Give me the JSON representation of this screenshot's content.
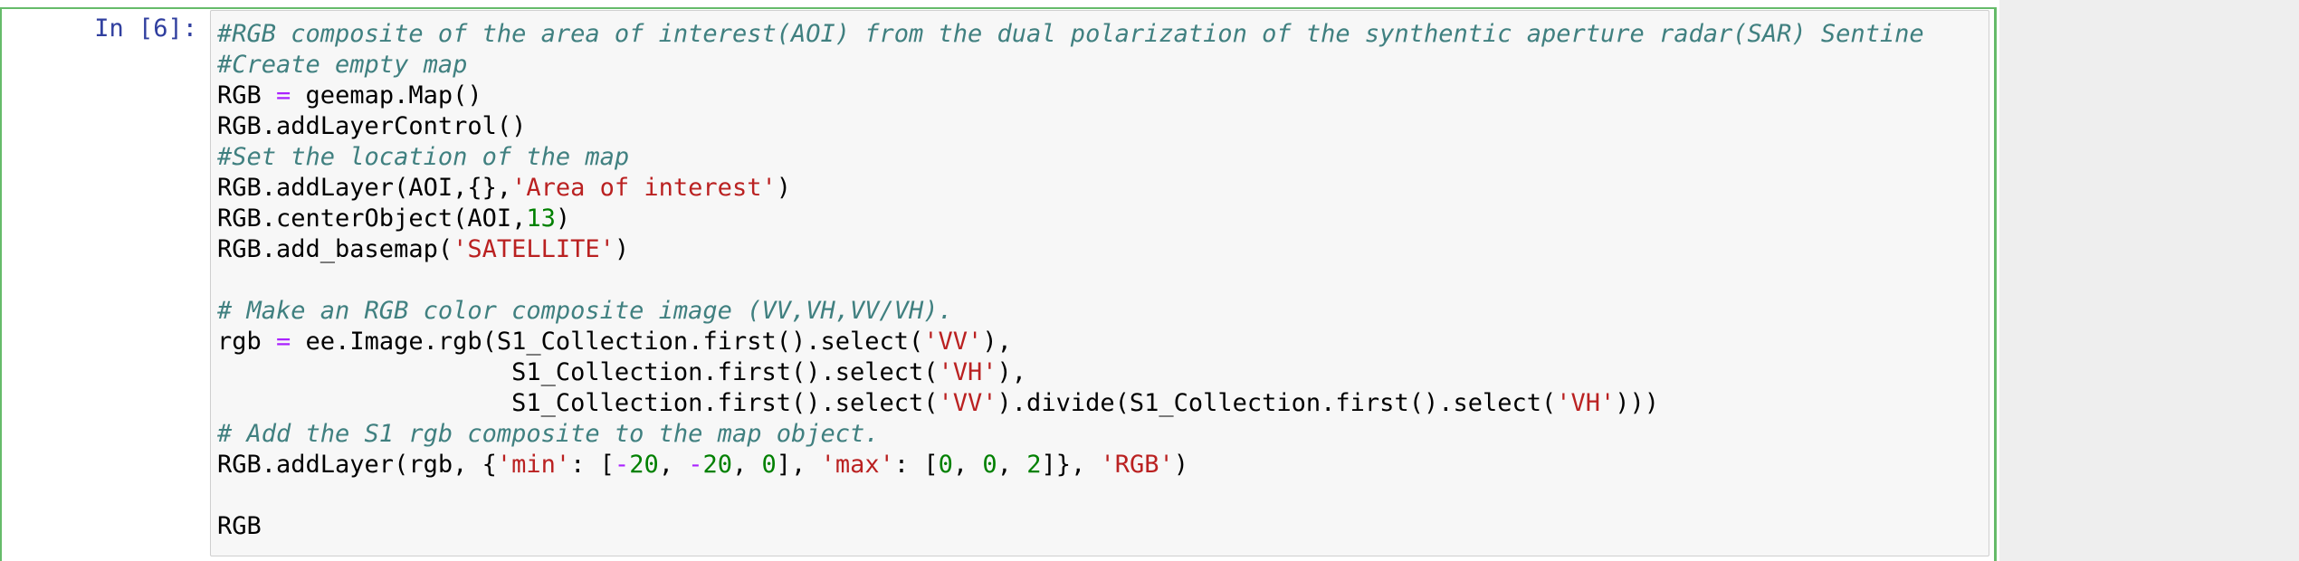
{
  "notebook": {
    "cell": {
      "prompt": "In [6]:",
      "lines": [
        [
          {
            "t": "#RGB composite of the area of interest(AOI) from the dual polarization of the synthentic aperture radar(SAR) Sentine",
            "k": "c"
          }
        ],
        [
          {
            "t": "#Create empty map",
            "k": "c"
          }
        ],
        [
          {
            "t": "RGB ",
            "k": "p"
          },
          {
            "t": "=",
            "k": "o"
          },
          {
            "t": " geemap.Map()",
            "k": "p"
          }
        ],
        [
          {
            "t": "RGB.addLayerControl()",
            "k": "p"
          }
        ],
        [
          {
            "t": "#Set the location of the map",
            "k": "c"
          }
        ],
        [
          {
            "t": "RGB.addLayer(AOI,{},",
            "k": "p"
          },
          {
            "t": "'Area of interest'",
            "k": "s"
          },
          {
            "t": ")",
            "k": "p"
          }
        ],
        [
          {
            "t": "RGB.centerObject(AOI,",
            "k": "p"
          },
          {
            "t": "13",
            "k": "n"
          },
          {
            "t": ")",
            "k": "p"
          }
        ],
        [
          {
            "t": "RGB.add_basemap(",
            "k": "p"
          },
          {
            "t": "'SATELLITE'",
            "k": "s"
          },
          {
            "t": ")",
            "k": "p"
          }
        ],
        [],
        [
          {
            "t": "# Make an RGB color composite image (VV,VH,VV/VH).",
            "k": "c"
          }
        ],
        [
          {
            "t": "rgb ",
            "k": "p"
          },
          {
            "t": "=",
            "k": "o"
          },
          {
            "t": " ee.Image.rgb(S1_Collection.first().select(",
            "k": "p"
          },
          {
            "t": "'VV'",
            "k": "s"
          },
          {
            "t": "),",
            "k": "p"
          }
        ],
        [
          {
            "t": "                    S1_Collection.first().select(",
            "k": "p"
          },
          {
            "t": "'VH'",
            "k": "s"
          },
          {
            "t": "),",
            "k": "p"
          }
        ],
        [
          {
            "t": "                    S1_Collection.first().select(",
            "k": "p"
          },
          {
            "t": "'VV'",
            "k": "s"
          },
          {
            "t": ").divide(S1_Collection.first().select(",
            "k": "p"
          },
          {
            "t": "'VH'",
            "k": "s"
          },
          {
            "t": ")))",
            "k": "p"
          }
        ],
        [
          {
            "t": "# Add the S1 rgb composite to the map object.",
            "k": "c"
          }
        ],
        [
          {
            "t": "RGB.addLayer(rgb, {",
            "k": "p"
          },
          {
            "t": "'min'",
            "k": "s"
          },
          {
            "t": ": [",
            "k": "p"
          },
          {
            "t": "-",
            "k": "o"
          },
          {
            "t": "20",
            "k": "n"
          },
          {
            "t": ", ",
            "k": "p"
          },
          {
            "t": "-",
            "k": "o"
          },
          {
            "t": "20",
            "k": "n"
          },
          {
            "t": ", ",
            "k": "p"
          },
          {
            "t": "0",
            "k": "n"
          },
          {
            "t": "], ",
            "k": "p"
          },
          {
            "t": "'max'",
            "k": "s"
          },
          {
            "t": ": [",
            "k": "p"
          },
          {
            "t": "0",
            "k": "n"
          },
          {
            "t": ", ",
            "k": "p"
          },
          {
            "t": "0",
            "k": "n"
          },
          {
            "t": ", ",
            "k": "p"
          },
          {
            "t": "2",
            "k": "n"
          },
          {
            "t": "]}, ",
            "k": "p"
          },
          {
            "t": "'RGB'",
            "k": "s"
          },
          {
            "t": ")",
            "k": "p"
          }
        ],
        [],
        [
          {
            "t": "RGB",
            "k": "p"
          }
        ]
      ]
    }
  },
  "colors": {
    "selected_cell_border": "#66bb6a",
    "prompt": "#303f9f",
    "comment": "#408080",
    "string": "#ba2121",
    "number": "#008000",
    "operator": "#aa22ff",
    "input_background": "#f7f7f7",
    "right_gutter": "#eeeeee"
  }
}
